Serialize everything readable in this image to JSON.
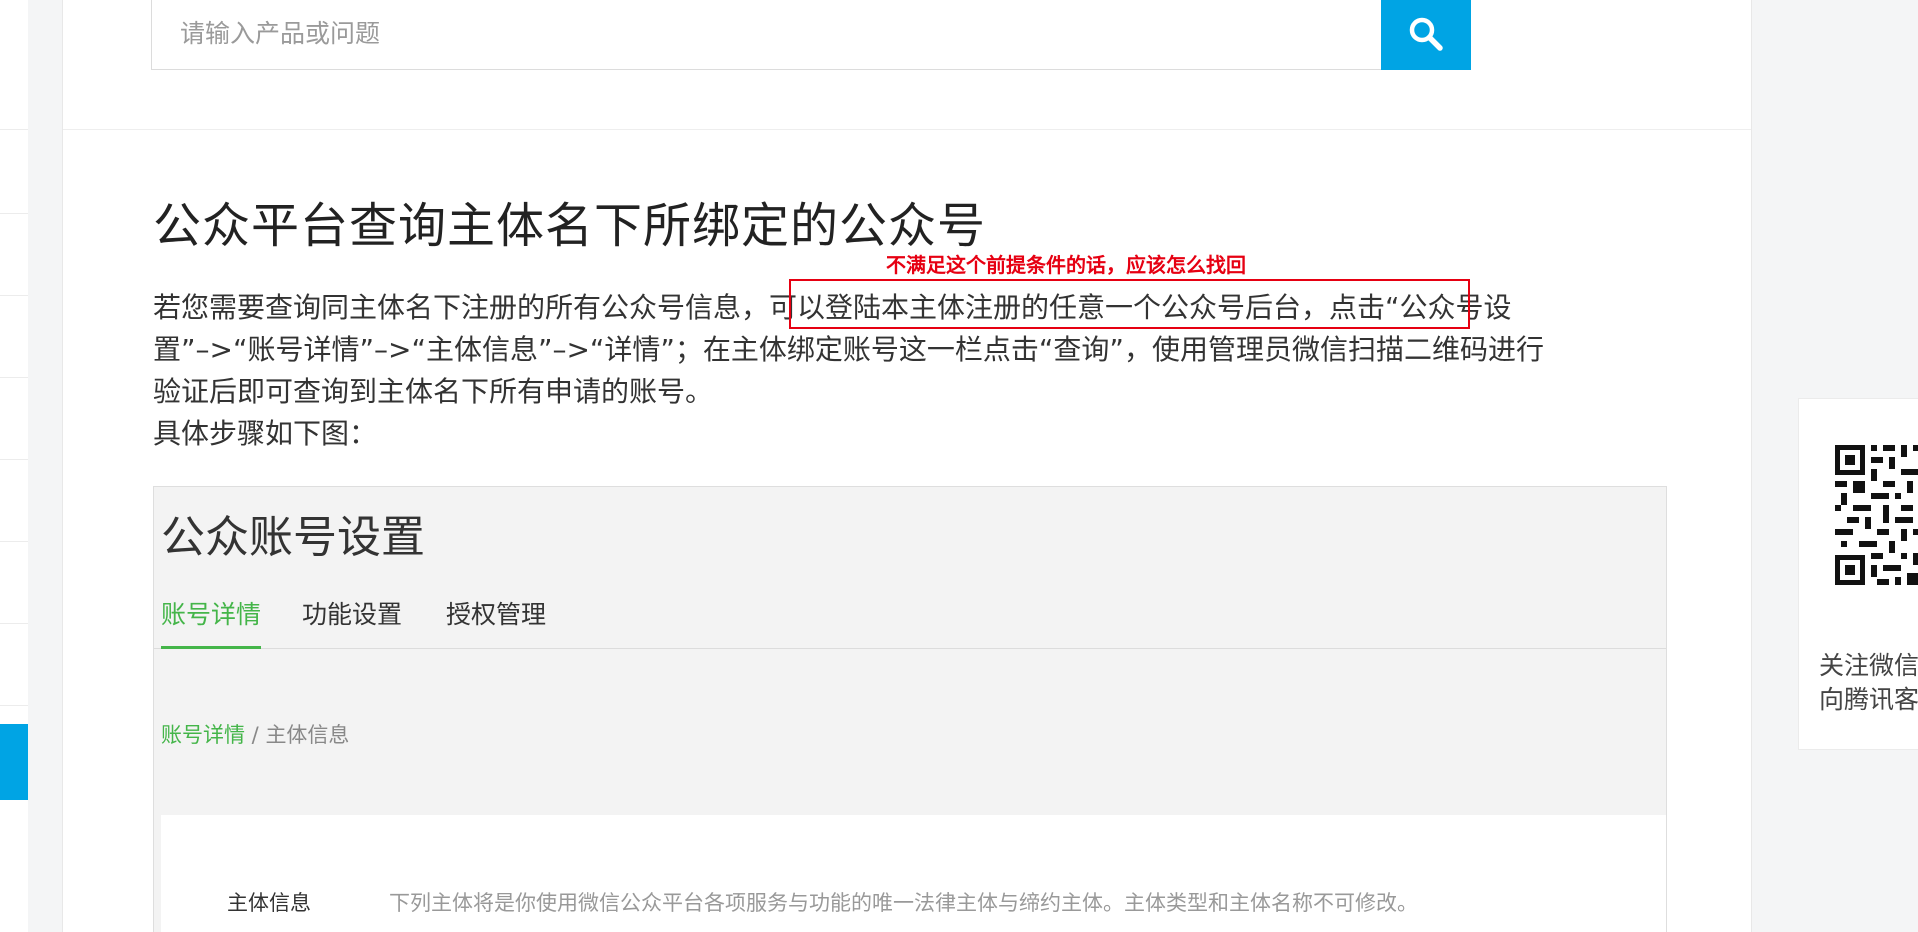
{
  "search": {
    "placeholder": "请输入产品或问题"
  },
  "article": {
    "title": "公众平台查询主体名下所绑定的公众号",
    "annotation": "不满足这个前提条件的话，应该怎么找回",
    "paragraph_lines": [
      "若您需要查询同主体名下注册的所有公众号信息，可以登陆本主体注册的任意一个公众号后台，点击“公众号设",
      "置”–>“账号详情”–>“主体信息”–>“详情”；在主体绑定账号这一栏点击“查询”，使用管理员微信扫描二维码进行",
      "验证后即可查询到主体名下所有申请的账号。",
      "具体步骤如下图："
    ]
  },
  "screenshot": {
    "title": "公众账号设置",
    "tabs": [
      {
        "label": "账号详情",
        "active": true
      },
      {
        "label": "功能设置",
        "active": false
      },
      {
        "label": "授权管理",
        "active": false
      }
    ],
    "breadcrumb": {
      "link": "账号详情",
      "separator": " / ",
      "current": "主体信息"
    },
    "field_label": "主体信息",
    "field_description": "下列主体将是你使用微信公众平台各项服务与功能的唯一法律主体与缔约主体。主体类型和主体名称不可修改。"
  },
  "follow": {
    "line1": "关注微信",
    "line2": "向腾讯客"
  },
  "colors": {
    "accent": "#00a4e4",
    "annotation": "#e60012",
    "wechat_green": "#44b549"
  }
}
